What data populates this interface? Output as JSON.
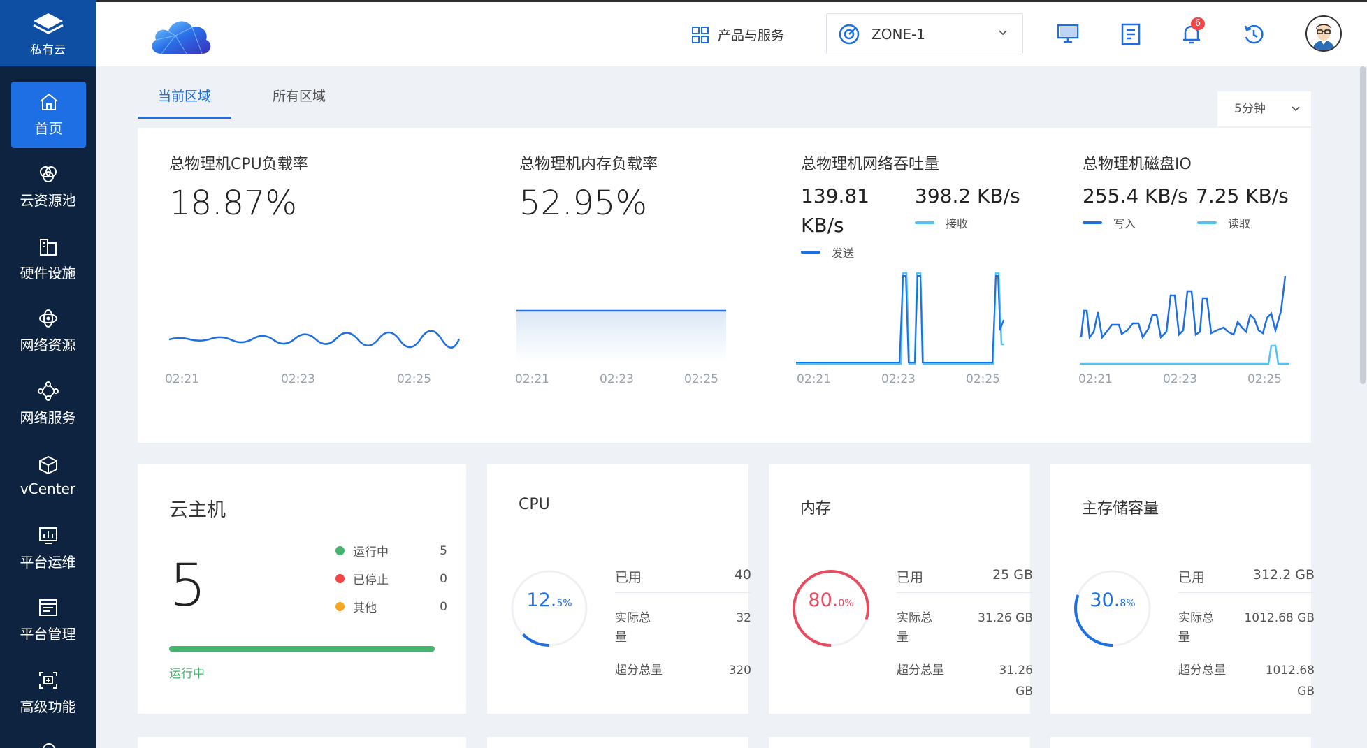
{
  "sidebar": {
    "brand": "私有云",
    "items": [
      {
        "label": "首页",
        "icon": "home-icon"
      },
      {
        "label": "云资源池",
        "icon": "resource-pool-icon"
      },
      {
        "label": "硬件设施",
        "icon": "hardware-icon"
      },
      {
        "label": "网络资源",
        "icon": "network-resource-icon"
      },
      {
        "label": "网络服务",
        "icon": "network-service-icon"
      },
      {
        "label": "vCenter",
        "icon": "vcenter-icon"
      },
      {
        "label": "平台运维",
        "icon": "ops-icon"
      },
      {
        "label": "平台管理",
        "icon": "management-icon"
      },
      {
        "label": "高级功能",
        "icon": "advanced-icon"
      }
    ]
  },
  "topbar": {
    "products_label": "产品与服务",
    "zone": "ZONE-1",
    "notification_count": "6"
  },
  "tabs": [
    {
      "label": "当前区域"
    },
    {
      "label": "所有区域"
    }
  ],
  "period": "5分钟",
  "metrics": {
    "cpu": {
      "title": "总物理机CPU负载率",
      "value": "18.87%"
    },
    "memory": {
      "title": "总物理机内存负载率",
      "value": "52.95%"
    },
    "network": {
      "title": "总物理机网络吞吐量",
      "send_value_line1": "139.81",
      "send_value_line2": "KB/s",
      "send_label": "发送",
      "recv_value": "398.2 KB/s",
      "recv_label": "接收"
    },
    "disk": {
      "title": "总物理机磁盘IO",
      "write_value": "255.4 KB/s",
      "write_label": "写入",
      "read_value": "7.25 KB/s",
      "read_label": "读取"
    },
    "time_ticks": [
      "02:21",
      "02:23",
      "02:25"
    ],
    "colors": {
      "primary": "#1d6fe3",
      "secondary": "#4fc3f7"
    }
  },
  "cards": {
    "vm": {
      "title": "云主机",
      "count": "5",
      "running_label": "运行中",
      "running": "5",
      "stopped_label": "已停止",
      "stopped": "0",
      "other_label": "其他",
      "other": "0",
      "bar_label": "运行中"
    },
    "cpu": {
      "title": "CPU",
      "percent_int": "12.",
      "percent_dec": "5%",
      "percent": 12.5,
      "used_label": "已用",
      "used": "40",
      "total_label_a": "实际总",
      "total_label_b": "量",
      "total": "32",
      "over_label": "超分总量",
      "over": "320"
    },
    "memory": {
      "title": "内存",
      "percent_int": "80.",
      "percent_dec": "0%",
      "percent": 80.0,
      "used_label": "已用",
      "used": "25 GB",
      "total_label_a": "实际总",
      "total_label_b": "量",
      "total": "31.26 GB",
      "over_label": "超分总量",
      "over_a": "31.26",
      "over_b": "GB"
    },
    "storage": {
      "title": "主存储容量",
      "percent_int": "30.",
      "percent_dec": "8%",
      "percent": 30.8,
      "used_label": "已用",
      "used": "312.2 GB",
      "total_label_a": "实际总",
      "total_label_b": "量",
      "total": "1012.68 GB",
      "over_label": "超分总量",
      "over_a": "1012.68",
      "over_b": "GB"
    }
  }
}
